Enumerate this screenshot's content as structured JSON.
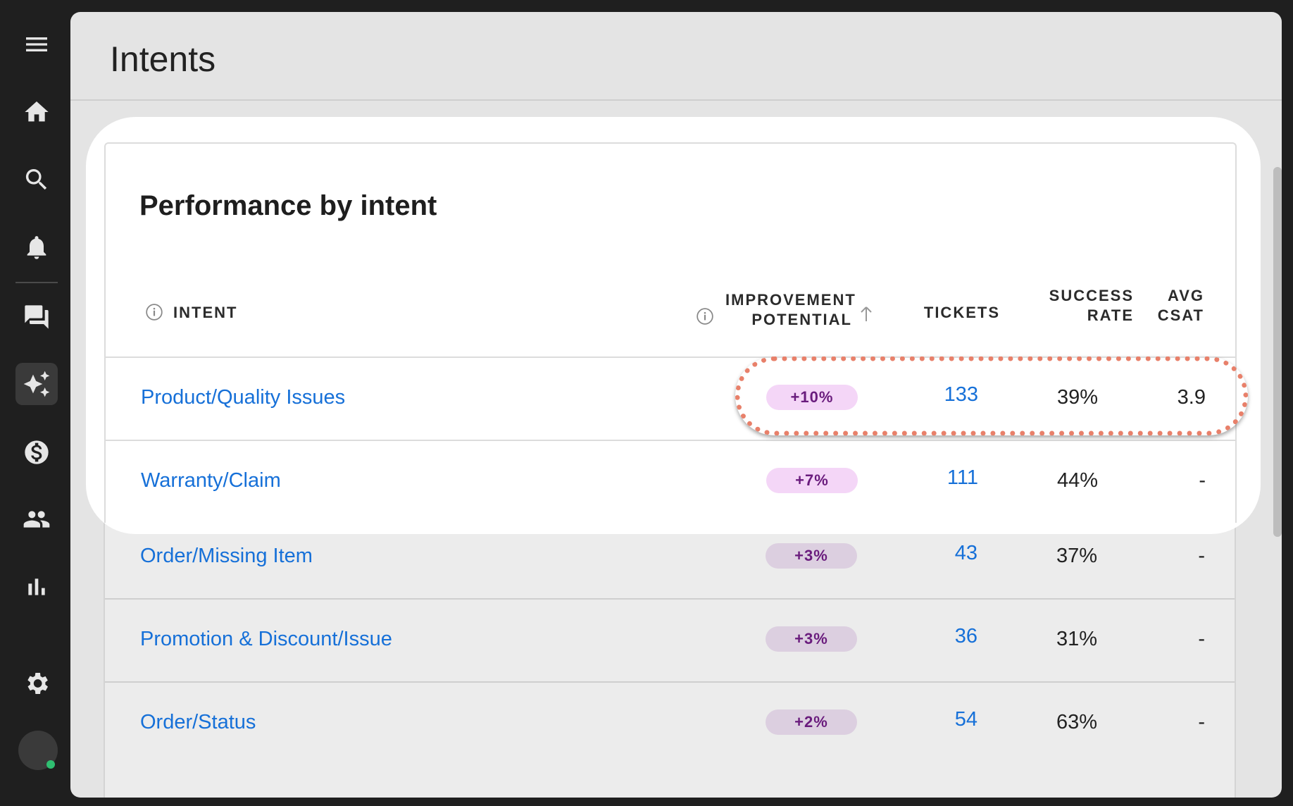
{
  "page": {
    "title": "Intents"
  },
  "sidebar": {
    "items": [
      {
        "name": "menu",
        "icon": "menu-icon"
      },
      {
        "name": "home",
        "icon": "home-icon"
      },
      {
        "name": "search",
        "icon": "search-icon"
      },
      {
        "name": "notifications",
        "icon": "bell-icon"
      },
      {
        "name": "conversations",
        "icon": "chat-icon"
      },
      {
        "name": "ai",
        "icon": "sparkles-icon",
        "active": true
      },
      {
        "name": "billing",
        "icon": "dollar-icon"
      },
      {
        "name": "team",
        "icon": "people-icon"
      },
      {
        "name": "analytics",
        "icon": "bar-chart-icon"
      },
      {
        "name": "settings",
        "icon": "gear-icon"
      }
    ]
  },
  "card": {
    "title": "Performance by intent",
    "columns": {
      "intent": "INTENT",
      "improvement_line1": "IMPROVEMENT",
      "improvement_line2": "POTENTIAL",
      "tickets": "TICKETS",
      "success_line1": "SUCCESS",
      "success_line2": "RATE",
      "csat_line1": "AVG",
      "csat_line2": "CSAT"
    },
    "rows": [
      {
        "intent": "Product/Quality Issues",
        "improvement": "+10%",
        "tickets": "133",
        "success": "39%",
        "csat": "3.9"
      },
      {
        "intent": "Warranty/Claim",
        "improvement": "+7%",
        "tickets": "111",
        "success": "44%",
        "csat": "-"
      },
      {
        "intent": "Order/Missing Item",
        "improvement": "+3%",
        "tickets": "43",
        "success": "37%",
        "csat": "-"
      },
      {
        "intent": "Promotion & Discount/Issue",
        "improvement": "+3%",
        "tickets": "36",
        "success": "31%",
        "csat": "-"
      },
      {
        "intent": "Order/Status",
        "improvement": "+2%",
        "tickets": "54",
        "success": "63%",
        "csat": "-"
      }
    ]
  },
  "colors": {
    "link": "#1670d8",
    "badge_bg": "#f4d6f7",
    "badge_text": "#6a1c7d",
    "highlight": "#e8806a"
  }
}
